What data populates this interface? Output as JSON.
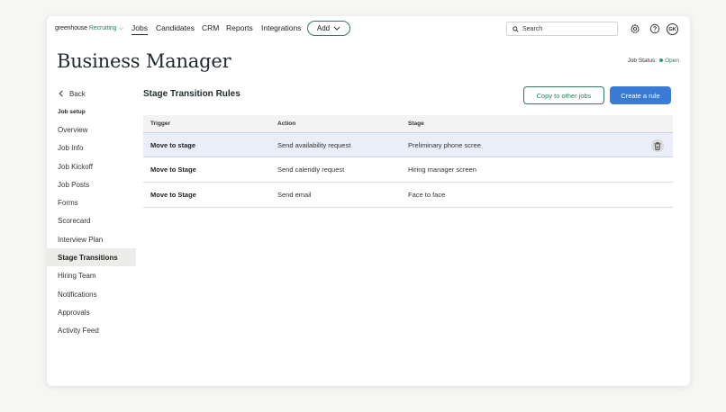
{
  "nav": {
    "brand_prefix": "greenhouse",
    "brand_product": "Recruiting",
    "brand_chevron": "⌵",
    "links": [
      "Jobs",
      "Candidates",
      "CRM",
      "Reports",
      "Integrations"
    ],
    "add_label": "Add",
    "search_placeholder": "Search",
    "settings_icon": "gear-icon",
    "help_icon": "help-icon",
    "avatar_initials": "GK"
  },
  "header": {
    "title": "Business Manager",
    "job_status_label": "Job Status:",
    "job_status_value": "Open",
    "status_color": "#2e9d6a"
  },
  "sidebar": {
    "back_label": "Back",
    "section_label": "Job setup",
    "items": [
      "Overview",
      "Job Info",
      "Job Kickoff",
      "Job Posts",
      "Forms",
      "Scorecard",
      "Interview Plan",
      "Stage Transitions",
      "Hiring Team",
      "Notifications",
      "Approvals",
      "Activity Feed"
    ],
    "active_item": "Stage Transitions"
  },
  "main": {
    "title": "Stage Transition Rules",
    "copy_button": "Copy to other jobs",
    "create_button": "Create a rule",
    "primary_color": "#3a7bd5",
    "accent_color": "#2e7d5b",
    "columns": [
      "Trigger",
      "Action",
      "Stage"
    ],
    "rows": [
      {
        "trigger": "Move to stage",
        "action": "Send availability request",
        "stage": "Preliminary phone scree"
      },
      {
        "trigger": "Move to Stage",
        "action": "Send calendly request",
        "stage": "Hiring manager screen"
      },
      {
        "trigger": "Move to Stage",
        "action": "Send email",
        "stage": "Face to face"
      }
    ],
    "selected_row": 0
  }
}
